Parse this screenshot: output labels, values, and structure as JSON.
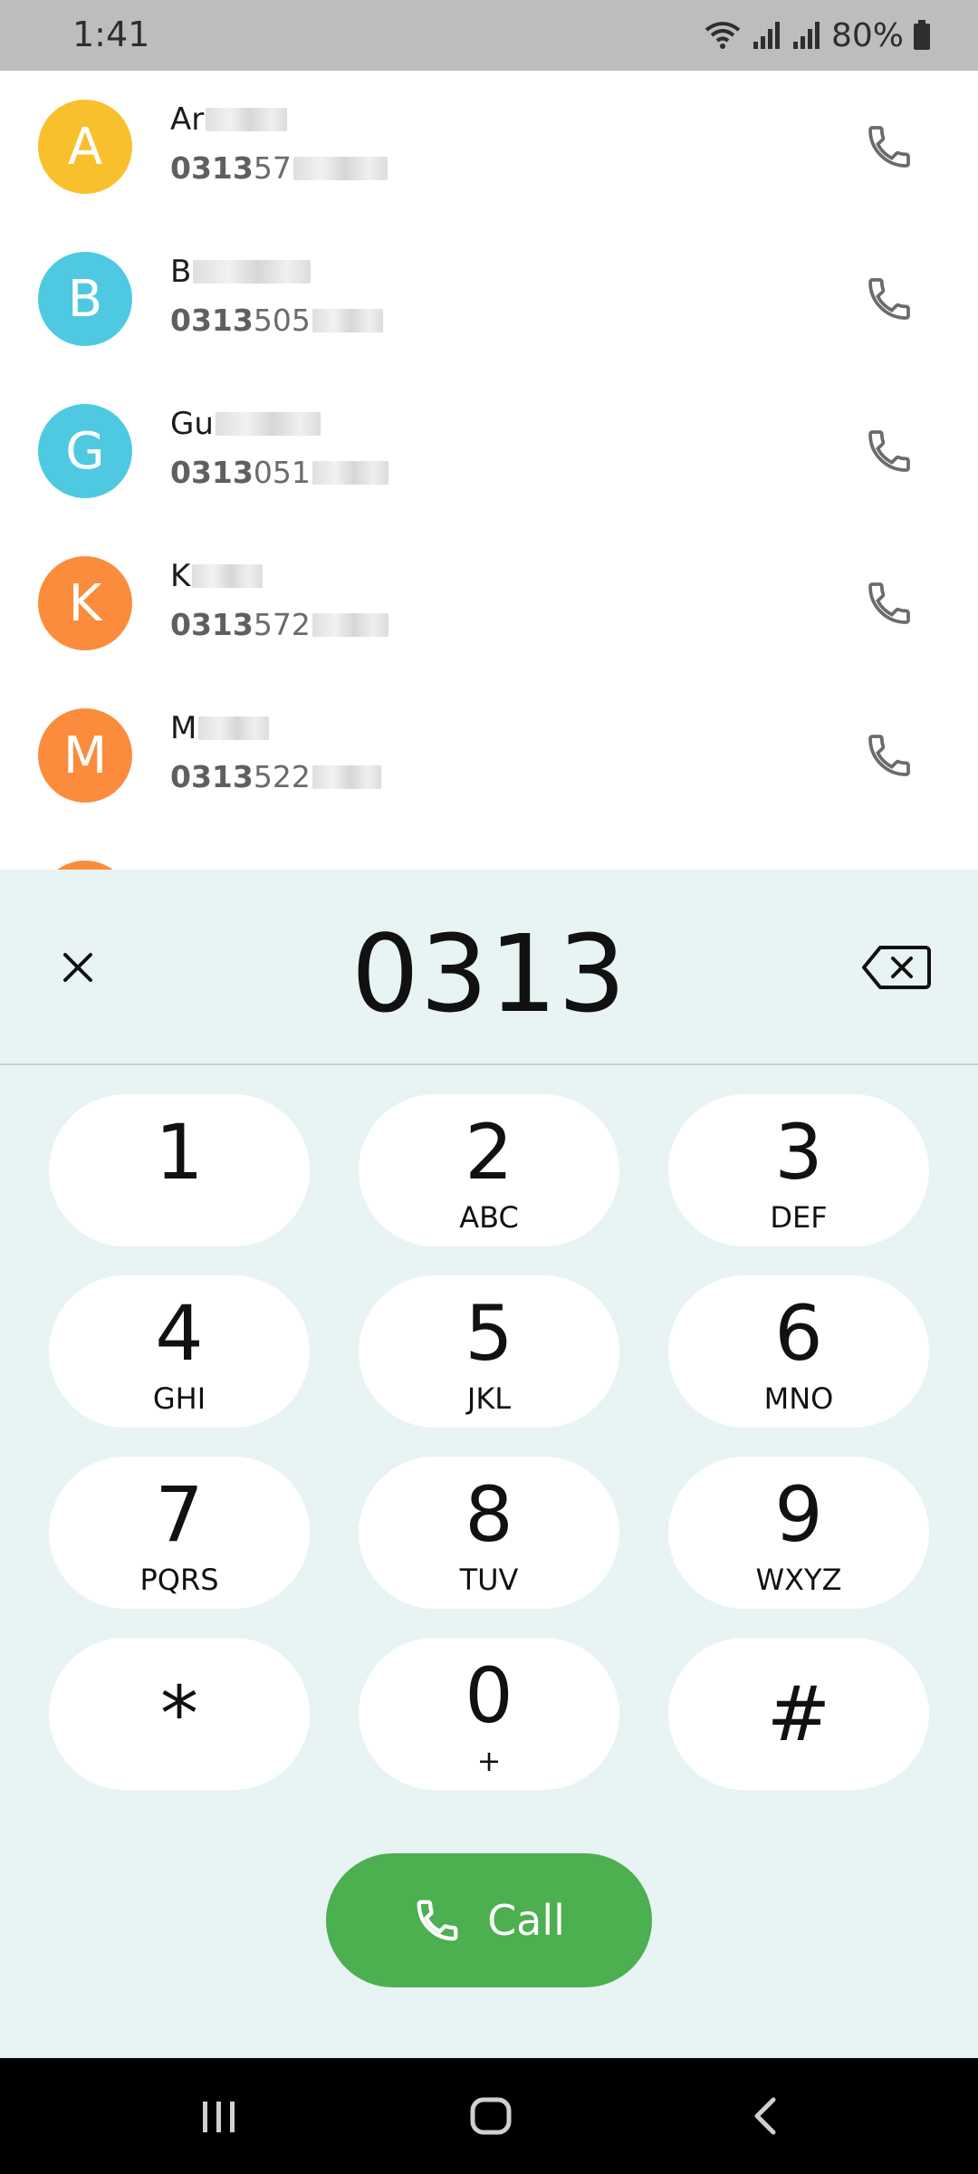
{
  "status_bar": {
    "time": "1:41",
    "battery": "80%"
  },
  "contacts": [
    {
      "initial": "A",
      "name_prefix": "Ar",
      "number_match": "0313",
      "number_rest": "57",
      "avatar_color": "#f9c02d"
    },
    {
      "initial": "B",
      "name_prefix": "B",
      "number_match": "0313",
      "number_rest": "505",
      "avatar_color": "#4ec9e1"
    },
    {
      "initial": "G",
      "name_prefix": "Gu",
      "number_match": "0313",
      "number_rest": "051",
      "avatar_color": "#4ec9e1"
    },
    {
      "initial": "K",
      "name_prefix": "K",
      "number_match": "0313",
      "number_rest": "572",
      "avatar_color": "#fb8c3c"
    },
    {
      "initial": "M",
      "name_prefix": "M",
      "number_match": "0313",
      "number_rest": "522",
      "avatar_color": "#fb8c3c"
    }
  ],
  "dialer": {
    "number": "0313",
    "keys": [
      {
        "digit": "1",
        "letters": ""
      },
      {
        "digit": "2",
        "letters": "ABC"
      },
      {
        "digit": "3",
        "letters": "DEF"
      },
      {
        "digit": "4",
        "letters": "GHI"
      },
      {
        "digit": "5",
        "letters": "JKL"
      },
      {
        "digit": "6",
        "letters": "MNO"
      },
      {
        "digit": "7",
        "letters": "PQRS"
      },
      {
        "digit": "8",
        "letters": "TUV"
      },
      {
        "digit": "9",
        "letters": "WXYZ"
      },
      {
        "digit": "*",
        "letters": ""
      },
      {
        "digit": "0",
        "letters": "+"
      },
      {
        "digit": "#",
        "letters": ""
      }
    ],
    "call_label": "Call"
  },
  "colors": {
    "call_green": "#4caf50",
    "dialer_bg": "#e8f4f3"
  },
  "icons": {
    "close": "close-icon",
    "backspace": "backspace-icon",
    "phone": "phone-icon",
    "nav_recents": "recent-apps-icon",
    "nav_home": "home-icon",
    "nav_back": "back-icon"
  }
}
